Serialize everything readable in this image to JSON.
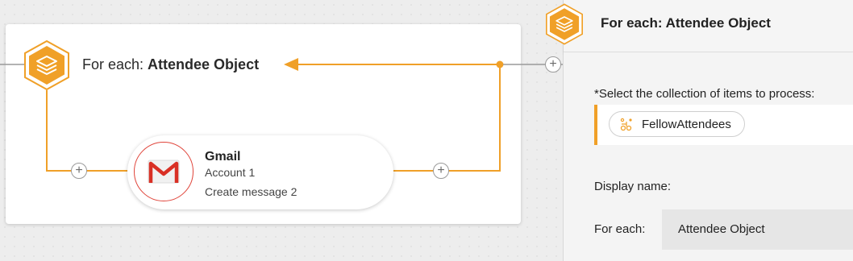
{
  "colors": {
    "accent": "#f0a028",
    "gmail_red": "#d93025",
    "wire": "#f0a028"
  },
  "canvas": {
    "loop": {
      "prefix": "For each: ",
      "name": "Attendee Object",
      "icon": "layers-icon"
    },
    "node": {
      "title": "Gmail",
      "account": "Account 1",
      "action": "Create message 2",
      "icon": "gmail-icon"
    }
  },
  "panel": {
    "title": "For each: Attendee Object",
    "icon": "layers-icon",
    "collection_label": "*Select the collection of items to process:",
    "collection_value": "FellowAttendees",
    "collection_icon": "collection-icon",
    "display_name_label": "Display name:",
    "for_each_label": "For each:",
    "for_each_value": "Attendee Object"
  }
}
